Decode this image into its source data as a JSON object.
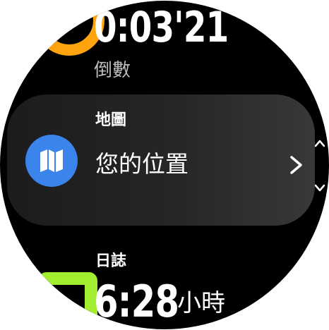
{
  "timer": {
    "value": "0:03'21",
    "label": "倒數",
    "ring_color": "#ffa30f"
  },
  "map_card": {
    "title": "地圖",
    "text": "您的位置",
    "icon": "map-icon",
    "icon_bg": "#3a84ec",
    "chevron": "chevron-right-icon"
  },
  "scroll": {
    "up_icon": "chevron-up-icon",
    "down_icon": "chevron-down-icon"
  },
  "log": {
    "title": "日誌",
    "value": "6:28",
    "unit": "小時",
    "ring_color": "#a0ee2f"
  }
}
